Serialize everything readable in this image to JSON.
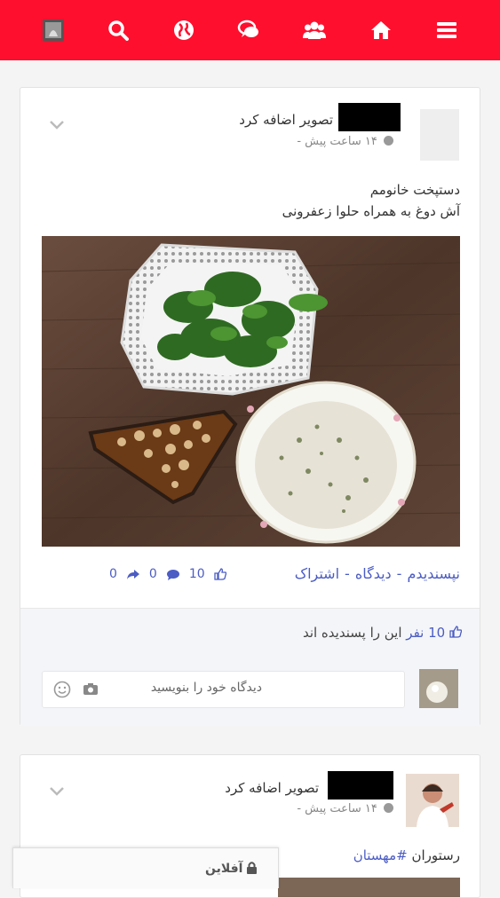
{
  "nav": {
    "items": [
      "menu-icon",
      "home-icon",
      "users-icon",
      "chat-icon",
      "globe-icon",
      "search-icon",
      "profile-icon"
    ],
    "accent": "#ff0f2e"
  },
  "post1": {
    "action_text": "تصویر اضافه کرد",
    "time": "۱۴ ساعت پیش -",
    "lines": [
      "دستپخت خانومم",
      "آش دوغ به همراه حلوا زعفرونی"
    ],
    "like_link": "نپسندیدم",
    "comment_link": "دیدگاه",
    "share_link": "اشتراک",
    "sep": "-",
    "like_count": "10",
    "comment_count": "0",
    "share_count": "0",
    "liked_by_count": "10",
    "liked_by_word": "نفر",
    "liked_by_text": "این را پسندیده اند",
    "comment_placeholder": "دیدگاه خود را بنویسید"
  },
  "post2": {
    "action_text": "تصویر اضافه کرد",
    "time": "۱۴ ساعت پیش -",
    "text_prefix": "رستوران",
    "hashtag": "#مهستان"
  },
  "chat": {
    "offline_label": "آفلاین"
  }
}
